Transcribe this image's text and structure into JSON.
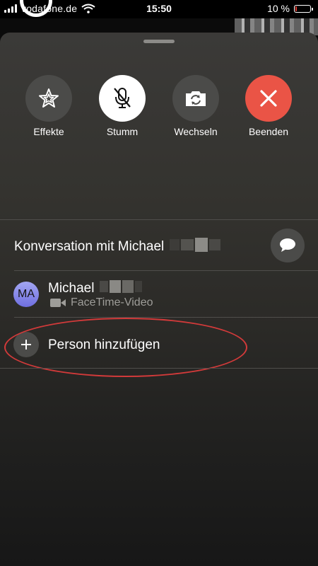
{
  "status_bar": {
    "carrier": "vodafone.de",
    "time": "15:50",
    "battery_text": "10 %",
    "battery_level": 0.1,
    "battery_color": "#e03a2f"
  },
  "controls": [
    {
      "label": "Effekte",
      "icon": "star-effects-icon"
    },
    {
      "label": "Stumm",
      "icon": "mic-off-icon"
    },
    {
      "label": "Wechseln",
      "icon": "camera-flip-icon"
    },
    {
      "label": "Beenden",
      "icon": "close-x-icon"
    }
  ],
  "conversation": {
    "title": "Konversation mit Michael",
    "message_icon": "chat-bubble-icon"
  },
  "participant": {
    "initials": "MA",
    "name": "Michael",
    "call_type": "FaceTime-Video",
    "call_icon": "video-camera-icon"
  },
  "add_person": {
    "label": "Person hinzufügen",
    "icon": "plus-icon"
  },
  "colors": {
    "end_call": "#ea5446",
    "annotation": "#d23a3a"
  }
}
